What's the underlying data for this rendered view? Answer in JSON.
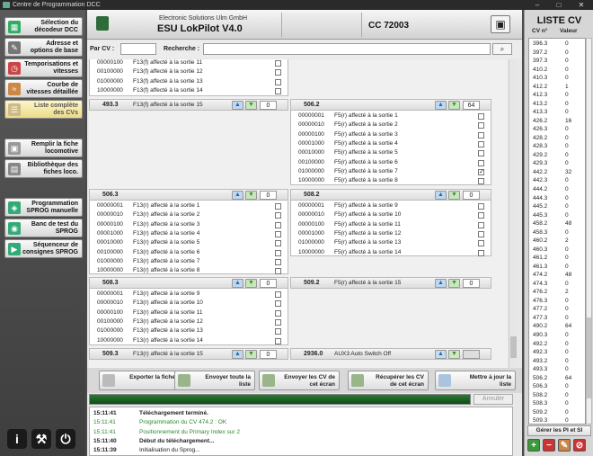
{
  "window": {
    "title": "Centre de Programmation DCC",
    "min": "–",
    "max": "□",
    "close": "✕"
  },
  "sidebar": {
    "items": [
      {
        "label": "Sélection du décodeur DCC",
        "icon": "▦"
      },
      {
        "label": "Adresse et options de base",
        "icon": "✎"
      },
      {
        "label": "Temporisations et vitesses",
        "icon": "◷"
      },
      {
        "label": "Courbe de vitesses détaillée",
        "icon": "≈"
      },
      {
        "label": "Liste complète des CVs",
        "icon": "☰"
      },
      {
        "label": "Remplir la fiche locomotive",
        "icon": "▣"
      },
      {
        "label": "Bibliothèque des fiches loco.",
        "icon": "▤"
      },
      {
        "label": "Programmation SPROG manuelle",
        "icon": "◈"
      },
      {
        "label": "Banc de test du SPROG",
        "icon": "◉"
      },
      {
        "label": "Séquenceur de consignes SPROG",
        "icon": "▶"
      }
    ],
    "info_icon": "i",
    "tools_icon": "⚒",
    "power_icon": "⏻"
  },
  "header": {
    "maker": "Electronic Solutions Ulm GmbH",
    "model": "ESU LokPilot V4.0",
    "decoder": "CC 72003",
    "save_icon": "▣"
  },
  "search": {
    "cv_label": "Par CV :",
    "cv_value": "",
    "search_label": "Recherche :",
    "search_value": "",
    "search_icon": "⌕"
  },
  "panels": {
    "p0": {
      "rows": [
        {
          "bits": "00000100",
          "text": "F13(f) affecté à la sortie 11",
          "checked": false
        },
        {
          "bits": "00100000",
          "text": "F13(f) affecté à la sortie 12",
          "checked": false
        },
        {
          "bits": "01000000",
          "text": "F13(f) affecté à la sortie 13",
          "checked": false
        },
        {
          "bits": "10000000",
          "text": "F13(f) affecté à la sortie 14",
          "checked": false
        }
      ]
    },
    "p4933": {
      "cv": "493.3",
      "desc": "F13(f) affecté à la sortie 15",
      "value": "0",
      "rows": []
    },
    "p5062": {
      "cv": "506.2",
      "desc": "",
      "value": "64",
      "rows": [
        {
          "bits": "00000001",
          "text": "F5(r) affecté à la sortie 1",
          "checked": false
        },
        {
          "bits": "00000010",
          "text": "F5(r) affecté à la sortie 2",
          "checked": false
        },
        {
          "bits": "00000100",
          "text": "F5(r) affecté à la sortie 3",
          "checked": false
        },
        {
          "bits": "00001000",
          "text": "F5(r) affecté à la sortie 4",
          "checked": false
        },
        {
          "bits": "00010000",
          "text": "F5(r) affecté à la sortie 5",
          "checked": false
        },
        {
          "bits": "00100000",
          "text": "F5(r) affecté à la sortie 6",
          "checked": false
        },
        {
          "bits": "01000000",
          "text": "F5(r) affecté à la sortie 7",
          "checked": true
        },
        {
          "bits": "10000000",
          "text": "F5(r) affecté à la sortie 8",
          "checked": false
        }
      ]
    },
    "p5063": {
      "cv": "506.3",
      "desc": "",
      "value": "0",
      "rows": [
        {
          "bits": "00000001",
          "text": "F13(r) affecté à la sortie 1",
          "checked": false
        },
        {
          "bits": "00000010",
          "text": "F13(r) affecté à la sortie 2",
          "checked": false
        },
        {
          "bits": "00000100",
          "text": "F13(r) affecté à la sortie 3",
          "checked": false
        },
        {
          "bits": "00001000",
          "text": "F13(r) affecté à la sortie 4",
          "checked": false
        },
        {
          "bits": "00010000",
          "text": "F13(r) affecté à la sortie 5",
          "checked": false
        },
        {
          "bits": "00100000",
          "text": "F13(r) affecté à la sortie 6",
          "checked": false
        },
        {
          "bits": "01000000",
          "text": "F13(r) affecté à la sortie 7",
          "checked": false
        },
        {
          "bits": "10000000",
          "text": "F13(r) affecté à la sortie 8",
          "checked": false
        }
      ]
    },
    "p5082": {
      "cv": "508.2",
      "desc": "",
      "value": "0",
      "rows": [
        {
          "bits": "00000001",
          "text": "F5(r) affecté à la sortie 9",
          "checked": false
        },
        {
          "bits": "00000010",
          "text": "F5(r) affecté à la sortie 10",
          "checked": false
        },
        {
          "bits": "00000100",
          "text": "F5(r) affecté à la sortie 11",
          "checked": false
        },
        {
          "bits": "00001000",
          "text": "F5(r) affecté à la sortie 12",
          "checked": false
        },
        {
          "bits": "01000000",
          "text": "F5(r) affecté à la sortie 13",
          "checked": false
        },
        {
          "bits": "10000000",
          "text": "F5(r) affecté à la sortie 14",
          "checked": false
        }
      ]
    },
    "p5083": {
      "cv": "508.3",
      "desc": "",
      "value": "0",
      "rows": [
        {
          "bits": "00000001",
          "text": "F13(r) affecté à la sortie 9",
          "checked": false
        },
        {
          "bits": "00000010",
          "text": "F13(r) affecté à la sortie 10",
          "checked": false
        },
        {
          "bits": "00000100",
          "text": "F13(r) affecté à la sortie 11",
          "checked": false
        },
        {
          "bits": "00100000",
          "text": "F13(r) affecté à la sortie 12",
          "checked": false
        },
        {
          "bits": "01000000",
          "text": "F13(r) affecté à la sortie 13",
          "checked": false
        },
        {
          "bits": "10000000",
          "text": "F13(r) affecté à la sortie 14",
          "checked": false
        }
      ]
    },
    "p5092": {
      "cv": "509.2",
      "desc": "F5(r) affecté à la sortie 15",
      "value": "0",
      "rows": []
    },
    "p5093": {
      "cv": "509.3",
      "desc": "F13(r) affecté à la sortie 15",
      "value": "0",
      "rows": []
    },
    "p2936": {
      "cv": "2936.0",
      "desc": "AUX3 Auto Switch Off",
      "value": "",
      "rows": []
    }
  },
  "actions": [
    {
      "label": "Exporter la fiche"
    },
    {
      "label": "Envoyer toute la liste"
    },
    {
      "label": "Envoyer les CV de cet écran"
    },
    {
      "label": "Récupérer les CV de cet écran"
    },
    {
      "label": "Mettre à jour la liste"
    }
  ],
  "progress": {
    "fraction": 1.0
  },
  "cancel_label": "Annuler",
  "log": [
    {
      "time": "15:11:41",
      "msg": "Téléchargement terminé.",
      "style": "k"
    },
    {
      "time": "15:11:41",
      "msg": "Programmation du CV 474.2 : OK",
      "style": "g"
    },
    {
      "time": "15:11:41",
      "msg": "Positionnement du Primary Index sur 2",
      "style": "g"
    },
    {
      "time": "15:11:40",
      "msg": "Début du téléchargement...",
      "style": "k"
    },
    {
      "time": "15:11:39",
      "msg": "Initialisation du Sprog...",
      "style": "n"
    }
  ],
  "cv_list": {
    "title": "LISTE CV",
    "col_cv": "CV n°",
    "col_val": "Valeur",
    "rows": [
      [
        "396.3",
        "0"
      ],
      [
        "397.2",
        "0"
      ],
      [
        "397.3",
        "0"
      ],
      [
        "410.2",
        "0"
      ],
      [
        "410.3",
        "0"
      ],
      [
        "412.2",
        "1"
      ],
      [
        "412.3",
        "0"
      ],
      [
        "413.2",
        "0"
      ],
      [
        "413.3",
        "0"
      ],
      [
        "426.2",
        "16"
      ],
      [
        "426.3",
        "0"
      ],
      [
        "428.2",
        "0"
      ],
      [
        "428.3",
        "0"
      ],
      [
        "429.2",
        "0"
      ],
      [
        "429.3",
        "0"
      ],
      [
        "442.2",
        "32"
      ],
      [
        "442.3",
        "0"
      ],
      [
        "444.2",
        "0"
      ],
      [
        "444.3",
        "0"
      ],
      [
        "445.2",
        "0"
      ],
      [
        "445.3",
        "0"
      ],
      [
        "458.2",
        "48"
      ],
      [
        "458.3",
        "0"
      ],
      [
        "460.2",
        "2"
      ],
      [
        "460.3",
        "0"
      ],
      [
        "461.2",
        "0"
      ],
      [
        "461.3",
        "0"
      ],
      [
        "474.2",
        "48"
      ],
      [
        "474.3",
        "0"
      ],
      [
        "476.2",
        "2"
      ],
      [
        "476.3",
        "0"
      ],
      [
        "477.2",
        "0"
      ],
      [
        "477.3",
        "0"
      ],
      [
        "490.2",
        "64"
      ],
      [
        "490.3",
        "0"
      ],
      [
        "492.2",
        "0"
      ],
      [
        "492.3",
        "0"
      ],
      [
        "493.2",
        "0"
      ],
      [
        "493.3",
        "0"
      ],
      [
        "506.2",
        "64"
      ],
      [
        "506.3",
        "0"
      ],
      [
        "508.2",
        "0"
      ],
      [
        "508.3",
        "0"
      ],
      [
        "509.2",
        "0"
      ],
      [
        "509.3",
        "0"
      ]
    ],
    "manage_label": "Gérer les PI et SI"
  }
}
